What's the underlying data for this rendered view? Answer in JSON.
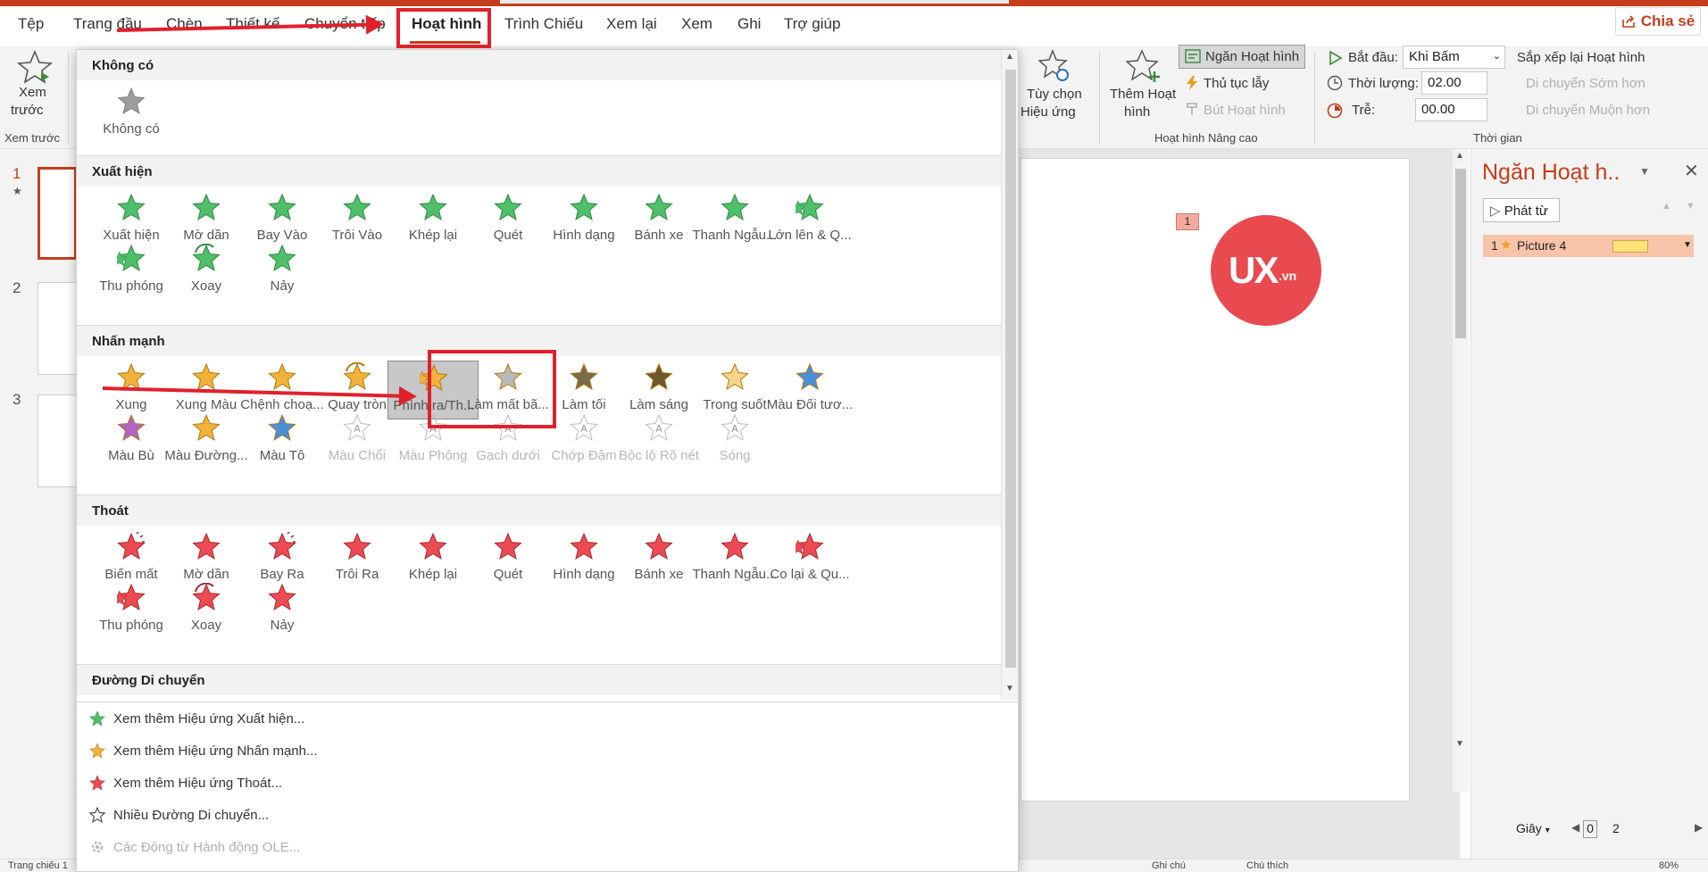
{
  "colors": {
    "accent": "#c43e1c",
    "highlight": "#e0212b",
    "entrance": "#4fbf6a",
    "emphasis": "#f2b13a",
    "exit": "#ec4b53"
  },
  "tabs": [
    "Tệp",
    "Trang đầu",
    "Chèn",
    "Thiết kế",
    "Chuyển tiếp",
    "Hoạt hình",
    "Trình Chiếu",
    "Xem lại",
    "Xem",
    "Ghi",
    "Trợ giúp"
  ],
  "share_label": "Chia sẻ",
  "ribbon": {
    "preview_l1": "Xem",
    "preview_l2": "trước",
    "preview_group": "Xem trước",
    "effect_options_l1": "Tùy chọn",
    "effect_options_l2": "Hiệu ứng",
    "add_anim_l1": "Thêm Hoạt",
    "add_anim_l2": "hình",
    "anim_pane_btn": "Ngăn Hoạt hình",
    "trigger": "Thủ tục lẫy",
    "painter": "Bút Hoạt hình",
    "advanced_group": "Hoạt hình Nâng cao",
    "start_label": "Bắt đầu:",
    "start_value": "Khi Bấm",
    "duration_label": "Thời lượng:",
    "duration_value": "02.00",
    "delay_label": "Trễ:",
    "delay_value": "00.00",
    "reorder": "Sắp xếp lại Hoạt hình",
    "move_earlier": "Di chuyển Sớm hơn",
    "move_later": "Di chuyển Muộn hơn",
    "timing_group": "Thời gian"
  },
  "thumbs": [
    "1",
    "2",
    "3"
  ],
  "status": {
    "left": "Trang chiếu 1",
    "notes": "Ghi chú",
    "comments": "Chú thích",
    "zoom": "80%"
  },
  "pane": {
    "title": "Ngăn Hoạt h..",
    "play_from": "Phát từ",
    "item_num": "1",
    "item_name": "Picture 4",
    "seconds": "Giây",
    "zoom_a": "0",
    "zoom_b": "2"
  },
  "slide": {
    "anim_tag": "1",
    "logo_main": "UX",
    "logo_sub": ".vn"
  },
  "gallery": {
    "none_head": "Không có",
    "none_item": "Không có",
    "entrance_head": "Xuất hiện",
    "entrance": [
      "Xuất hiện",
      "Mờ dần",
      "Bay Vào",
      "Trôi Vào",
      "Khép lại",
      "Quét",
      "Hình dạng",
      "Bánh xe",
      "Thanh Ngẫu...",
      "Lớn lên & Q...",
      "Thu phóng",
      "Xoay",
      "Nảy"
    ],
    "emphasis_head": "Nhấn mạnh",
    "emphasis": [
      "Xung",
      "Xung Màu",
      "Chệnh choạ...",
      "Quay tròn",
      "Phình ra/Th...",
      "Làm mất bã...",
      "Làm tối",
      "Làm sáng",
      "Trong suốt",
      "Màu Đối tươ...",
      "Màu Bù",
      "Màu Đường...",
      "Màu Tô",
      "Màu Chổi",
      "Màu Phông",
      "Gạch dưới",
      "Chớp Đậm",
      "Bộc lộ Rõ nét",
      "Sóng"
    ],
    "exit_head": "Thoát",
    "exit": [
      "Biến mất",
      "Mờ dần",
      "Bay Ra",
      "Trôi Ra",
      "Khép lại",
      "Quét",
      "Hình dạng",
      "Bánh xe",
      "Thanh Ngẫu...",
      "Co lại & Qu...",
      "Thu phóng",
      "Xoay",
      "Nảy"
    ],
    "motion_head": "Đường Di chuyển",
    "more": [
      "Xem thêm Hiệu ứng Xuất hiện...",
      "Xem thêm Hiệu ứng Nhấn mạnh...",
      "Xem thêm Hiệu ứng Thoát...",
      "Nhiều Đường Di chuyển...",
      "Các Động từ Hành động OLE..."
    ]
  }
}
